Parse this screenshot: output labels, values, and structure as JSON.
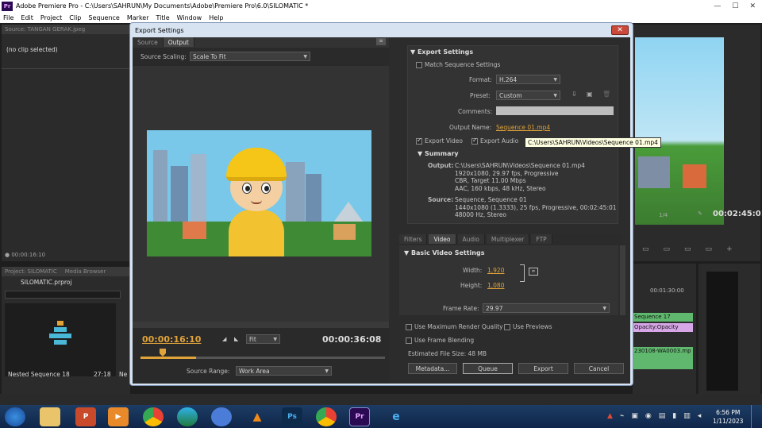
{
  "window": {
    "title": "Adobe Premiere Pro - C:\\Users\\SAHRUN\\My Documents\\Adobe\\Premiere Pro\\6.0\\SILOMATIC *",
    "app_icon": "Pr"
  },
  "menu": [
    "File",
    "Edit",
    "Project",
    "Clip",
    "Sequence",
    "Marker",
    "Title",
    "Window",
    "Help"
  ],
  "source_panel": {
    "tab": "Source: TANGAN GERAK.jpeg",
    "no_clip": "(no clip selected)",
    "timecode": "00:00:16:10"
  },
  "project_panel": {
    "tabs": [
      "Project: SILOMATIC",
      "Media Browser"
    ],
    "file": "SILOMATIC.prproj",
    "item_name": "Nested Sequence 18",
    "item_duration": "27:18",
    "item_more": "Ne"
  },
  "program_panel": {
    "fraction": "1/4",
    "timecode": "00:02:45:01"
  },
  "timeline_bg": {
    "time": "00:01:30:00",
    "clips": [
      "Sequence 17",
      "Opacity:Opacity",
      "230108-WA0003.mp"
    ]
  },
  "export": {
    "dialog_title": "Export Settings",
    "close": "✕",
    "left_tabs": [
      "Source",
      "Output"
    ],
    "source_scaling_label": "Source Scaling:",
    "source_scaling_value": "Scale To Fit",
    "current_time": "00:00:16:10",
    "fit": "Fit",
    "end_time": "00:00:36:08",
    "source_range_label": "Source Range:",
    "source_range_value": "Work Area",
    "settings_header": "Export Settings",
    "match_sequence": "Match Sequence Settings",
    "format_label": "Format:",
    "format_value": "H.264",
    "preset_label": "Preset:",
    "preset_value": "Custom",
    "comments_label": "Comments:",
    "output_name_label": "Output Name:",
    "output_name_value": "Sequence 01.mp4",
    "export_video": "Export Video",
    "export_audio": "Export Audio",
    "tooltip": "C:\\Users\\SAHRUN\\Videos\\Sequence 01.mp4",
    "summary_header": "Summary",
    "output_label": "Output:",
    "output_lines": [
      "C:\\Users\\SAHRUN\\Videos\\Sequence 01.mp4",
      "1920x1080, 29.97 fps, Progressive",
      "CBR, Target 11.00 Mbps",
      "AAC, 160 kbps, 48 kHz, Stereo"
    ],
    "source_label": "Source:",
    "source_lines": [
      "Sequence, Sequence 01",
      "1440x1080 (1.3333), 25 fps, Progressive, 00:02:45:01",
      "48000 Hz, Stereo"
    ],
    "right_tabs": [
      "Filters",
      "Video",
      "Audio",
      "Multiplexer",
      "FTP"
    ],
    "basic_video_header": "Basic Video Settings",
    "width_label": "Width:",
    "width_value": "1,920",
    "height_label": "Height:",
    "height_value": "1,080",
    "frame_rate_label": "Frame Rate:",
    "frame_rate_value": "29.97",
    "max_render": "Use Maximum Render Quality",
    "use_previews": "Use Previews",
    "frame_blending": "Use Frame Blending",
    "file_size_label": "Estimated File Size:",
    "file_size_value": "48 MB",
    "buttons": [
      "Metadata...",
      "Queue",
      "Export",
      "Cancel"
    ]
  },
  "taskbar": {
    "time": "6:56 PM",
    "date": "1/11/2023"
  },
  "colors": {
    "accent_orange": "#e0a33a",
    "sky": "#79c8ea",
    "cap_yellow": "#f5c518"
  }
}
